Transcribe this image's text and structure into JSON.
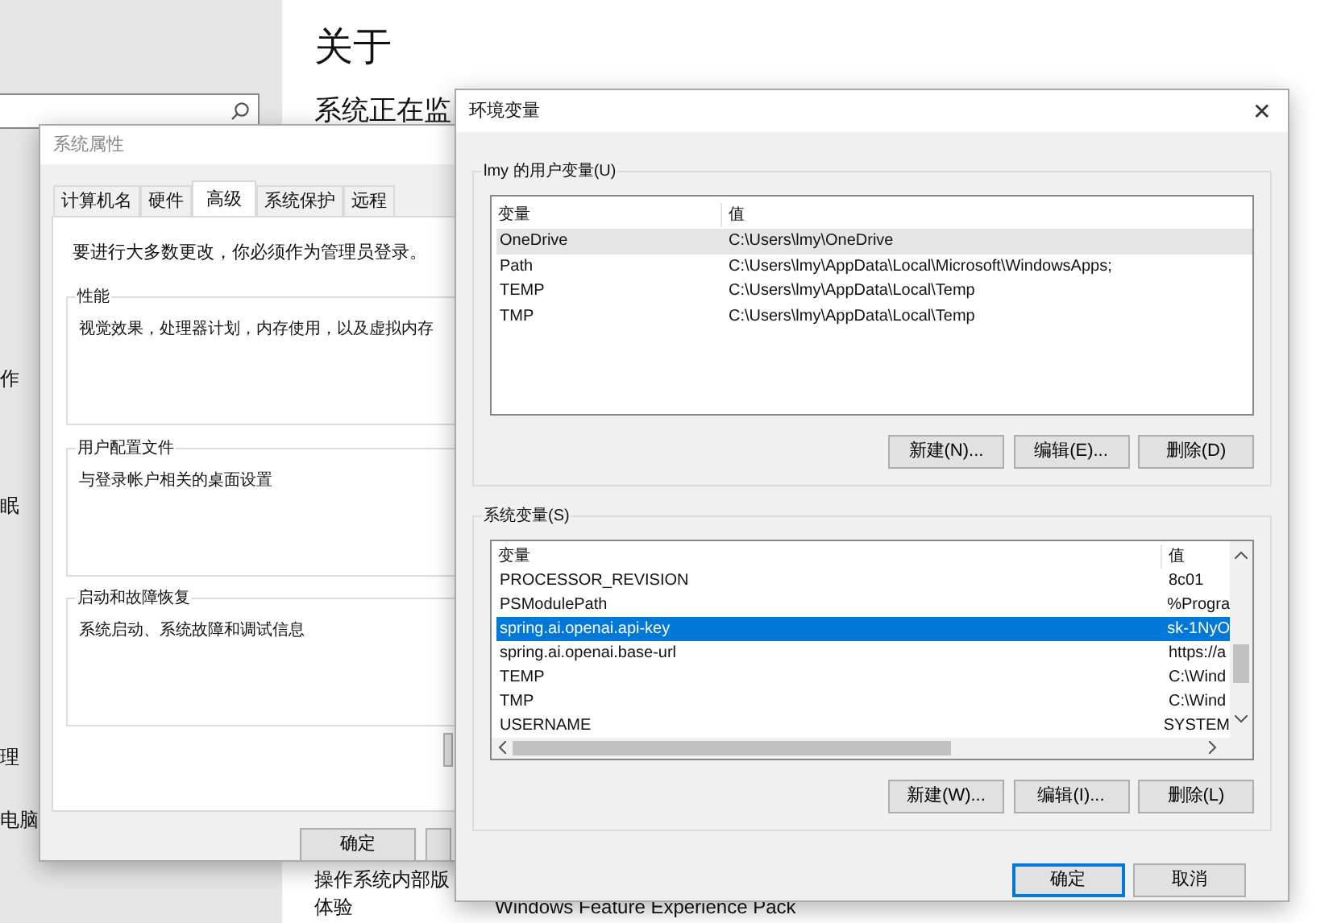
{
  "settings_sidebar": {
    "items": [
      "作",
      "眠",
      "理",
      "电脑"
    ]
  },
  "about_page": {
    "title": "关于",
    "subtitle": "系统正在监",
    "lines": [
      "操作系统内部版",
      "体验"
    ],
    "spec_value": "Windows Feature Experience Pack"
  },
  "system_properties": {
    "title": "系统属性",
    "tabs": [
      {
        "label": "计算机名",
        "selected": false
      },
      {
        "label": "硬件",
        "selected": false
      },
      {
        "label": "高级",
        "selected": true
      },
      {
        "label": "系统保护",
        "selected": false
      },
      {
        "label": "远程",
        "selected": false
      }
    ],
    "notice": "要进行大多数更改，你必须作为管理员登录。",
    "groups": [
      {
        "title": "性能",
        "description": "视觉效果，处理器计划，内存使用，以及虚拟内存"
      },
      {
        "title": "用户配置文件",
        "description": "与登录帐户相关的桌面设置"
      },
      {
        "title": "启动和故障恢复",
        "description": "系统启动、系统故障和调试信息"
      }
    ],
    "buttons": [
      "确定"
    ]
  },
  "environment_variables": {
    "title": "环境变量",
    "close": "✕",
    "user_variables": {
      "title": "lmy 的用户变量(U)",
      "focused": false,
      "columns": [
        "变量",
        "值"
      ],
      "rows": [
        {
          "name": "OneDrive",
          "value": "C:\\Users\\lmy\\OneDrive",
          "selected": true
        },
        {
          "name": "Path",
          "value": "C:\\Users\\lmy\\AppData\\Local\\Microsoft\\WindowsApps;",
          "selected": false
        },
        {
          "name": "TEMP",
          "value": "C:\\Users\\lmy\\AppData\\Local\\Temp",
          "selected": false
        },
        {
          "name": "TMP",
          "value": "C:\\Users\\lmy\\AppData\\Local\\Temp",
          "selected": false
        }
      ],
      "buttons": [
        "新建(N)...",
        "编辑(E)...",
        "删除(D)"
      ]
    },
    "system_variables": {
      "title": "系统变量(S)",
      "focused": true,
      "columns": [
        "变量",
        "值"
      ],
      "rows": [
        {
          "name": "PROCESSOR_REVISION",
          "value": "8c01",
          "selected": false
        },
        {
          "name": "PSModulePath",
          "value": "%Progra",
          "selected": false
        },
        {
          "name": "spring.ai.openai.api-key",
          "value": "sk-1NyO",
          "selected": true
        },
        {
          "name": "spring.ai.openai.base-url",
          "value": "https://a",
          "selected": false
        },
        {
          "name": "TEMP",
          "value": "C:\\Wind",
          "selected": false
        },
        {
          "name": "TMP",
          "value": "C:\\Wind",
          "selected": false
        },
        {
          "name": "USERNAME",
          "value": "SYSTEM",
          "selected": false
        }
      ],
      "buttons": [
        "新建(W)...",
        "编辑(I)...",
        "删除(L)"
      ]
    },
    "buttons": [
      {
        "label": "确定",
        "default": true
      },
      {
        "label": "取消",
        "default": false
      }
    ]
  }
}
